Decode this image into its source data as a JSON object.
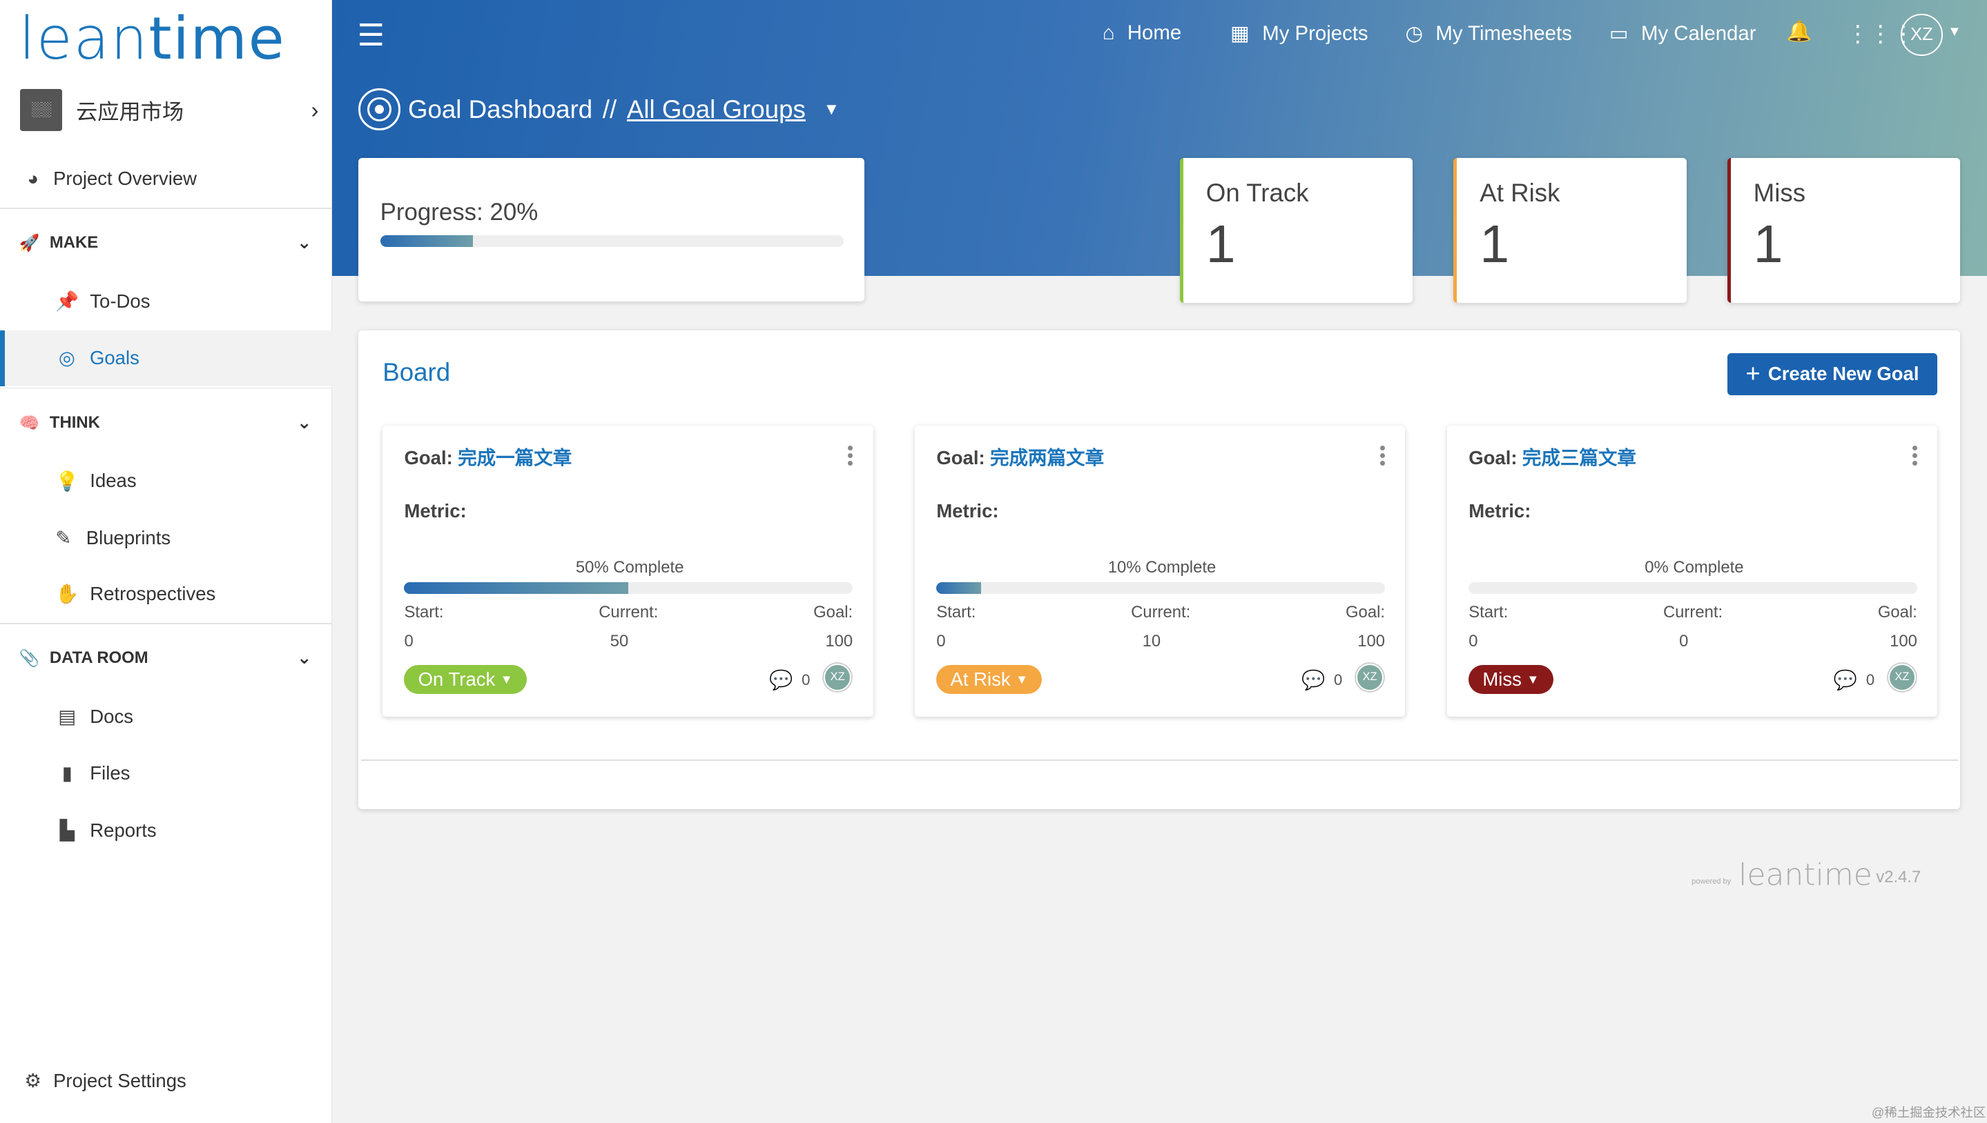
{
  "app": {
    "logo_lean": "lean",
    "logo_time": "time"
  },
  "sidebar": {
    "project_avatar": "░░",
    "project_name": "云应用市场",
    "overview": "Project Overview",
    "sections": [
      {
        "label": "MAKE",
        "items": [
          "To-Dos",
          "Goals"
        ]
      },
      {
        "label": "THINK",
        "items": [
          "Ideas",
          "Blueprints",
          "Retrospectives"
        ]
      },
      {
        "label": "DATA ROOM",
        "items": [
          "Docs",
          "Files",
          "Reports"
        ]
      }
    ],
    "settings": "Project Settings"
  },
  "nav": {
    "home": "Home",
    "projects": "My Projects",
    "timesheets": "My Timesheets",
    "calendar": "My Calendar",
    "user_initials": "XZ"
  },
  "breadcrumb": {
    "title": "Goal Dashboard",
    "separator": "//",
    "group": "All Goal Groups"
  },
  "progress": {
    "label": "Progress: 20%",
    "value": 0.2
  },
  "stats": [
    {
      "label": "On Track",
      "value": "1",
      "color": "#8dc63f"
    },
    {
      "label": "At Risk",
      "value": "1",
      "color": "#f5a742"
    },
    {
      "label": "Miss",
      "value": "1",
      "color": "#8a1a1a"
    }
  ],
  "board": {
    "title": "Board",
    "create_label": "Create New Goal",
    "goals": [
      {
        "prefix": "Goal:",
        "name": "完成一篇文章",
        "metric": "Metric:",
        "complete": "50% Complete",
        "progress": 0.5,
        "start_label": "Start:",
        "current_label": "Current:",
        "goal_label": "Goal:",
        "start": "0",
        "current": "50",
        "goal": "100",
        "status": "On Track",
        "status_color": "#8dc63f",
        "comments": "0",
        "assignee": "XZ"
      },
      {
        "prefix": "Goal:",
        "name": "完成两篇文章",
        "metric": "Metric:",
        "complete": "10% Complete",
        "progress": 0.1,
        "start_label": "Start:",
        "current_label": "Current:",
        "goal_label": "Goal:",
        "start": "0",
        "current": "10",
        "goal": "100",
        "status": "At Risk",
        "status_color": "#f5a742",
        "comments": "0",
        "assignee": "XZ"
      },
      {
        "prefix": "Goal:",
        "name": "完成三篇文章",
        "metric": "Metric:",
        "complete": "0% Complete",
        "progress": 0.0,
        "start_label": "Start:",
        "current_label": "Current:",
        "goal_label": "Goal:",
        "start": "0",
        "current": "0",
        "goal": "100",
        "status": "Miss",
        "status_color": "#8a1a1a",
        "comments": "0",
        "assignee": "XZ"
      }
    ]
  },
  "footer": {
    "powered_by": "powered by",
    "brand": "leantime",
    "version": "v2.4.7",
    "watermark": "@稀土掘金技术社区"
  },
  "icons": {
    "overview": "palette-icon",
    "make": "rocket-icon",
    "todos": "thumbtack-icon",
    "goals": "bullseye-icon",
    "think": "brain-icon",
    "ideas": "lightbulb-icon",
    "blueprints": "compass-drafting-icon",
    "retros": "hand-icon",
    "dataroom": "paperclip-icon",
    "docs": "book-icon",
    "files": "file-icon",
    "reports": "chart-icon",
    "settings": "gear-icon"
  }
}
